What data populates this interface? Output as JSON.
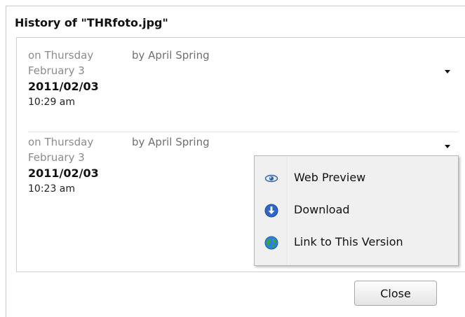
{
  "dialog": {
    "title": "History of \"THRfoto.jpg\""
  },
  "entries": [
    {
      "weekday": "on Thursday",
      "monthday": "February 3",
      "by": "by April Spring",
      "date": "2011/02/03",
      "time": "10:29 am"
    },
    {
      "weekday": "on Thursday",
      "monthday": "February 3",
      "by": "by April Spring",
      "date": "2011/02/03",
      "time": "10:23 am"
    }
  ],
  "menu": {
    "items": [
      {
        "label": "Web Preview",
        "icon": "eye-icon"
      },
      {
        "label": "Download",
        "icon": "download-icon"
      },
      {
        "label": "Link to This Version",
        "icon": "globe-icon"
      }
    ]
  },
  "buttons": {
    "close": "Close"
  },
  "colors": {
    "menu_background": "#f0f0f0",
    "download_icon": "#2f66c8",
    "globe_blue": "#2b82d9",
    "globe_green": "#3aa33a"
  }
}
